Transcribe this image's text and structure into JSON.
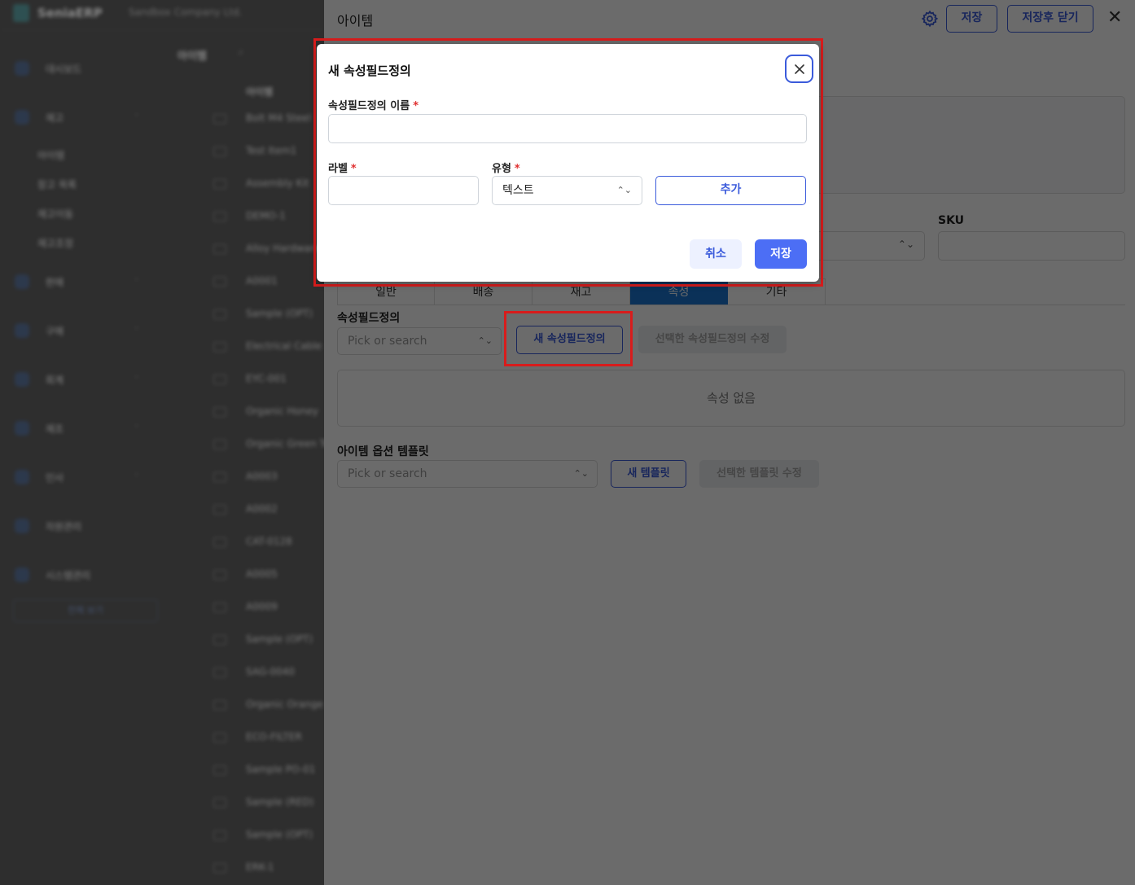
{
  "app": {
    "brand": "SeniaERP",
    "company": "Sandbox Company Ltd.",
    "sidebar": [
      {
        "label": "대시보드"
      },
      {
        "label": "재고"
      },
      {
        "label": "판매"
      },
      {
        "label": "구매"
      },
      {
        "label": "회계"
      },
      {
        "label": "제조"
      },
      {
        "label": "인사"
      },
      {
        "label": "자원관리"
      },
      {
        "label": "시스템관리"
      }
    ],
    "sub_items": [
      "아이템",
      "창고 목록",
      "재고이동",
      "재고조정"
    ],
    "side_button": "전체 보기",
    "list": {
      "title": "아이템",
      "column": "아이템",
      "rows": [
        "Bolt M4 Steel",
        "Test Item1",
        "Assembly Kit",
        "DEMO-1",
        "Alloy Hardware",
        "A0001",
        "Sample (OPT)",
        "Electrical Cable",
        "EYC-001",
        "Organic Honey",
        "Organic Green Tea",
        "A0003",
        "A0002",
        "CAT-0128",
        "A0005",
        "A0009",
        "Sample (OPT)",
        "SAG-0040",
        "Organic Orange",
        "ECO-FILTER",
        "Sample PO-01",
        "Sample (RED)",
        "Sample (OPT)",
        "ERK-1"
      ]
    }
  },
  "panel": {
    "title": "아이템",
    "save": "저장",
    "save_close": "저장후 닫기",
    "sku_label": "SKU",
    "tabs": [
      "일반",
      "배송",
      "재고",
      "속성",
      "기타"
    ],
    "attr_section": {
      "label": "속성필드정의",
      "placeholder": "Pick or search",
      "new_button": "새 속성필드정의",
      "edit_button": "선택한 속성필드정의 수정",
      "empty": "속성 없음"
    },
    "template_section": {
      "label": "아이템 옵션 템플릿",
      "placeholder": "Pick or search",
      "new_button": "새 템플릿",
      "edit_button": "선택한 템플릿 수정"
    }
  },
  "modal": {
    "title": "새 속성필드정의",
    "name_label": "속성필드정의 이름",
    "required_mark": "*",
    "label_label": "라벨",
    "type_label": "유형",
    "type_value": "텍스트",
    "add_button": "추가",
    "cancel": "취소",
    "save": "저장"
  }
}
